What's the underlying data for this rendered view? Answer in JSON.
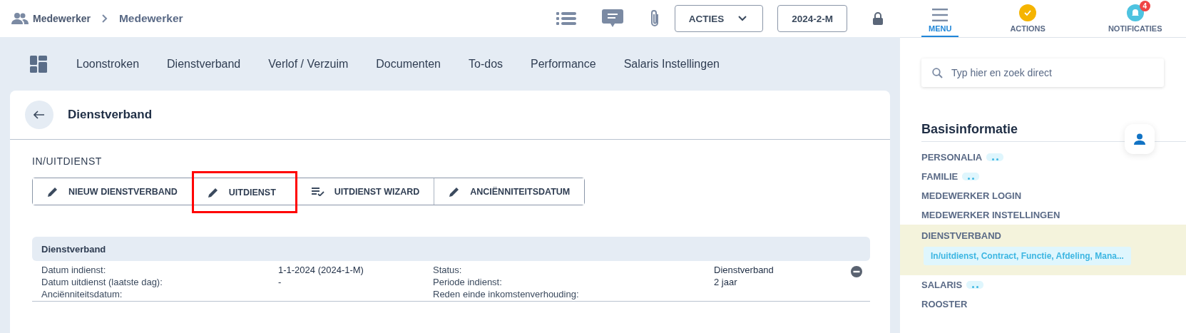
{
  "breadcrumb": {
    "items": [
      "Medewerker",
      "Medewerker"
    ]
  },
  "toolbar": {
    "actions_button": "ACTIES",
    "period_button": "2024-2-M",
    "locked": true
  },
  "tabs": [
    {
      "label": "Loonstroken"
    },
    {
      "label": "Dienstverband"
    },
    {
      "label": "Verlof / Verzuim"
    },
    {
      "label": "Documenten"
    },
    {
      "label": "To-dos"
    },
    {
      "label": "Performance"
    },
    {
      "label": "Salaris Instellingen"
    }
  ],
  "card": {
    "title": "Dienstverband",
    "section_title": "IN/UITDIENST",
    "buttons": [
      {
        "label": "NIEUW DIENSTVERBAND",
        "kind": "edit",
        "highlighted": false
      },
      {
        "label": "UITDIENST",
        "kind": "edit",
        "highlighted": true
      },
      {
        "label": "UITDIENST WIZARD",
        "kind": "wizard",
        "highlighted": false
      },
      {
        "label": "ANCIËNNITEITSDATUM",
        "kind": "edit",
        "highlighted": false
      }
    ],
    "table": {
      "title": "Dienstverband",
      "rows": [
        {
          "label": "Datum indienst:",
          "value": "1-1-2024 (2024-1-M)",
          "label_2": "Status:",
          "value_2": "Dienstverband"
        },
        {
          "label": "Datum uitdienst (laatste dag):",
          "value": "-",
          "label_2": "Periode indienst:",
          "value_2": "2 jaar"
        },
        {
          "label": "Anciënniteitsdatum:",
          "label_2": "Reden einde inkomstenverhouding:"
        }
      ]
    }
  },
  "panel": {
    "tabs": [
      {
        "label": "MENU",
        "kind": "menu",
        "selected": true
      },
      {
        "label": "ACTIONS",
        "kind": "actions",
        "selected": false
      },
      {
        "label": "NOTIFICATIES",
        "kind": "notifications",
        "badge": "4",
        "selected": false
      }
    ],
    "search": {
      "placeholder": "Typ hier en zoek direct"
    },
    "section_title": "Basisinformatie",
    "items": [
      {
        "label": "PERSONALIA",
        "more": true,
        "selected": false
      },
      {
        "label": "FAMILIE",
        "more": true,
        "selected": false
      },
      {
        "label": "MEDEWERKER LOGIN",
        "more": false,
        "selected": false
      },
      {
        "label": "MEDEWERKER INSTELLINGEN",
        "more": false,
        "selected": false
      },
      {
        "label": "DIENSTVERBAND",
        "more": false,
        "selected": true,
        "subtitle": "In/uitdienst, Contract, Functie, Afdeling, Mana..."
      },
      {
        "label": "SALARIS",
        "more": true,
        "selected": false
      },
      {
        "label": "ROOSTER",
        "more": false,
        "selected": false
      }
    ]
  }
}
